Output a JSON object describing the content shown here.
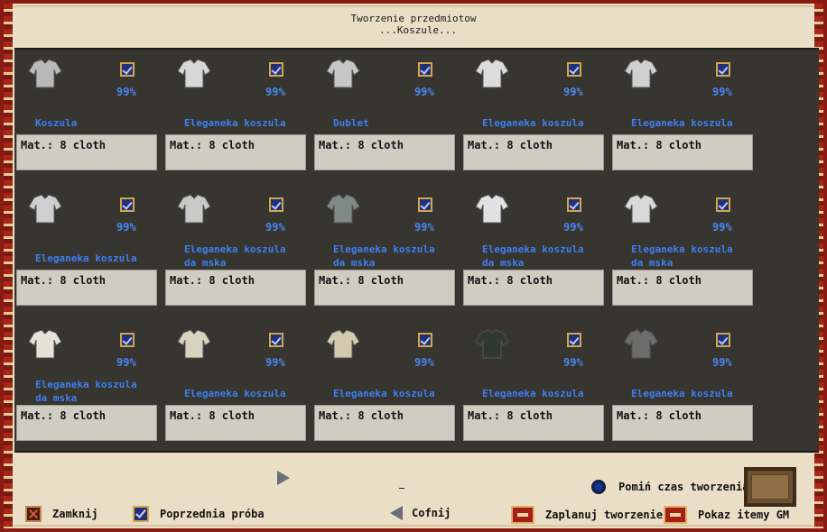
{
  "header": {
    "title": "Tworzenie przedmiotow",
    "subtitle": "...Koszule..."
  },
  "items": [
    {
      "name": "Koszula",
      "chance": "99%",
      "mat": "Mat.: 8 cloth",
      "color": "#b9b9b9"
    },
    {
      "name": "Eleganeka koszula",
      "chance": "99%",
      "mat": "Mat.: 8 cloth",
      "color": "#d7d7d7"
    },
    {
      "name": "Dublet",
      "chance": "99%",
      "mat": "Mat.: 8 cloth",
      "color": "#c7c7c7"
    },
    {
      "name": "Eleganeka koszula",
      "chance": "99%",
      "mat": "Mat.: 8 cloth",
      "color": "#dcdcdc"
    },
    {
      "name": "Eleganeka koszula",
      "chance": "99%",
      "mat": "Mat.: 8 cloth",
      "color": "#d0d0d0"
    },
    {
      "name": "Eleganeka koszula",
      "chance": "99%",
      "mat": "Mat.: 8 cloth",
      "color": "#cfcfcf"
    },
    {
      "name": "Eleganeka koszula da mska",
      "chance": "99%",
      "mat": "Mat.: 8 cloth",
      "color": "#c9c9c9"
    },
    {
      "name": "Eleganeka koszula da mska",
      "chance": "99%",
      "mat": "Mat.: 8 cloth",
      "color": "#7d8a86"
    },
    {
      "name": "Eleganeka koszula da mska",
      "chance": "99%",
      "mat": "Mat.: 8 cloth",
      "color": "#e2e2e2"
    },
    {
      "name": "Eleganeka koszula da mska",
      "chance": "99%",
      "mat": "Mat.: 8 cloth",
      "color": "#d9d9d9"
    },
    {
      "name": "Eleganeka koszula da mska",
      "chance": "99%",
      "mat": "Mat.: 8 cloth",
      "color": "#e8e2d6"
    },
    {
      "name": "Eleganeka koszula",
      "chance": "99%",
      "mat": "Mat.: 8 cloth",
      "color": "#d8d2c0"
    },
    {
      "name": "Eleganeka koszula",
      "chance": "99%",
      "mat": "Mat.: 8 cloth",
      "color": "#d3cbb0"
    },
    {
      "name": "Eleganeka koszula",
      "chance": "99%",
      "mat": "Mat.: 8 cloth",
      "color": "#2f3a2f"
    },
    {
      "name": "Eleganeka koszula",
      "chance": "99%",
      "mat": "Mat.: 8 cloth",
      "color": "#6c6c6c"
    }
  ],
  "footer": {
    "skip_time": "Pomiń czas tworzenia",
    "close": "Zamknij",
    "previous": "Poprzednia próba",
    "back": "Cofnij",
    "schedule": "Zaplanuj tworzenie",
    "show_gm": "Pokaz itemy GM"
  }
}
